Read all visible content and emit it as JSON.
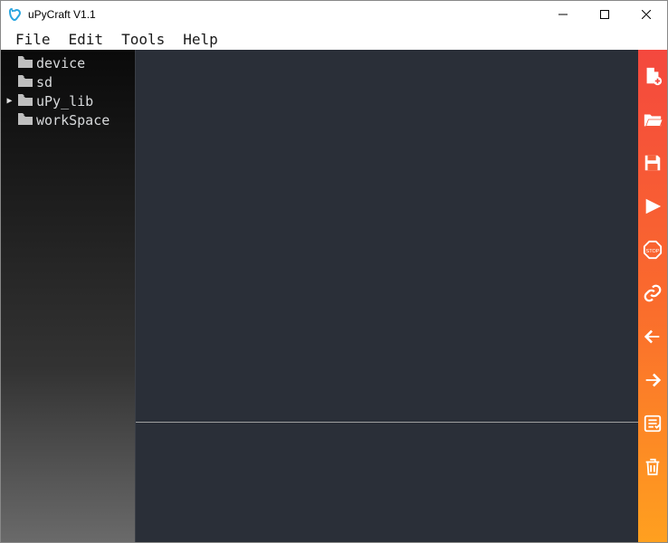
{
  "window": {
    "title": "uPyCraft V1.1"
  },
  "menu": {
    "items": [
      "File",
      "Edit",
      "Tools",
      "Help"
    ]
  },
  "sidebar": {
    "items": [
      {
        "label": "device",
        "expandable": false
      },
      {
        "label": "sd",
        "expandable": false
      },
      {
        "label": "uPy_lib",
        "expandable": true
      },
      {
        "label": "workSpace",
        "expandable": false
      }
    ]
  },
  "toolbar": {
    "buttons": [
      {
        "name": "new-file-button",
        "icon": "new-file-icon"
      },
      {
        "name": "open-file-button",
        "icon": "open-file-icon"
      },
      {
        "name": "save-button",
        "icon": "save-icon"
      },
      {
        "name": "run-button",
        "icon": "run-icon"
      },
      {
        "name": "stop-button",
        "icon": "stop-icon"
      },
      {
        "name": "connect-button",
        "icon": "link-icon"
      },
      {
        "name": "undo-button",
        "icon": "undo-icon"
      },
      {
        "name": "redo-button",
        "icon": "redo-icon"
      },
      {
        "name": "checklist-button",
        "icon": "checklist-icon"
      },
      {
        "name": "delete-button",
        "icon": "trash-icon"
      }
    ]
  }
}
